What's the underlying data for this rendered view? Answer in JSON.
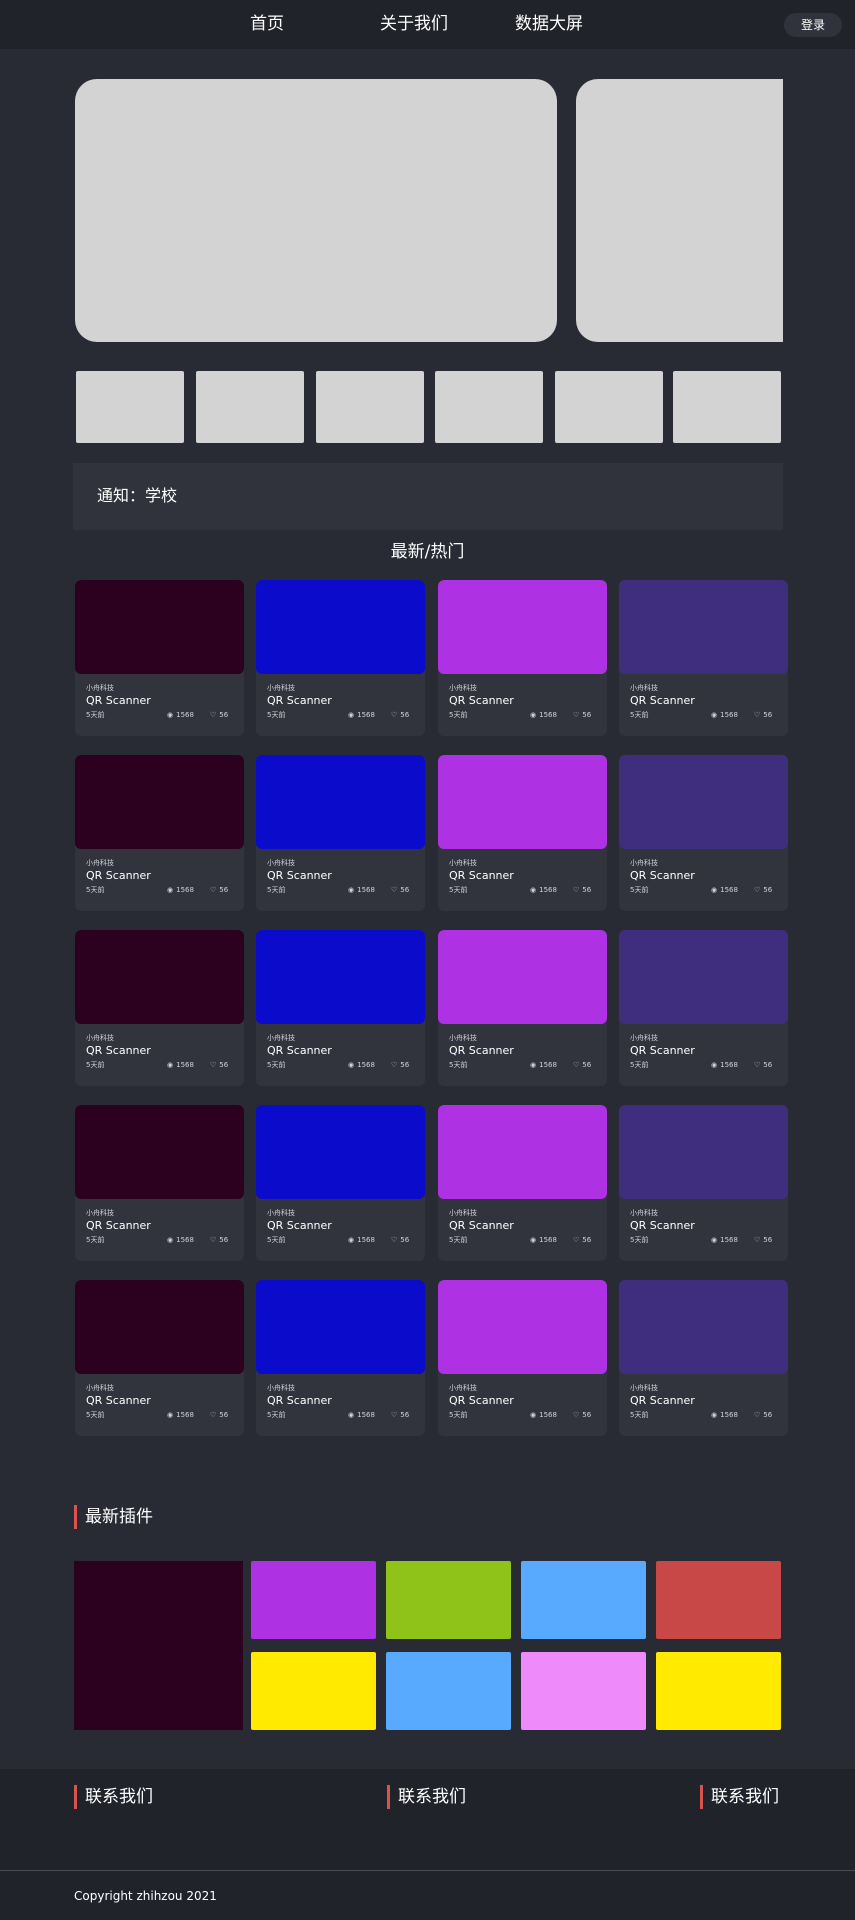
{
  "nav": {
    "items": [
      "首页",
      "关于我们",
      "数据大屏"
    ],
    "login": "登录"
  },
  "notice": {
    "text": "通知：学校"
  },
  "section": {
    "title": "最新/热门"
  },
  "card_colors": [
    "#2c001f",
    "#0a0bcb",
    "#ae32e4",
    "#3f2e7e"
  ],
  "card": {
    "company": "小舟科技",
    "title": "QR Scanner",
    "time": "5天前",
    "views": "1568",
    "likes": "56",
    "views_icon": "eye-icon",
    "likes_icon": "heart-icon"
  },
  "plugins": {
    "title": "最新插件",
    "big_color": "#2c001f",
    "colors": [
      "#ae32e4",
      "#8fc31a",
      "#57aaff",
      "#c84848",
      "#ffea00",
      "#57aaff",
      "#ee8afa",
      "#ffea00"
    ]
  },
  "footer": {
    "contacts": [
      "联系我们",
      "联系我们",
      "联系我们"
    ],
    "copyright": "Copyright zhihzou 2021"
  },
  "colors": {
    "background": "#282b33",
    "topbar": "#21232a",
    "accent": "#d9534f",
    "placeholder": "#d3d3d3"
  }
}
